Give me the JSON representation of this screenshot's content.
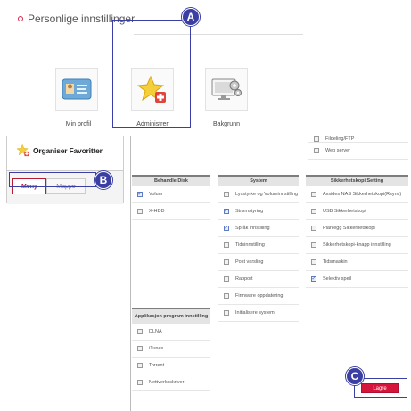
{
  "personal_settings": {
    "title": "Personlige innstillinger",
    "tiles": [
      {
        "label": "Min profil",
        "icon": "id-card-icon"
      },
      {
        "label": "Administrer",
        "icon": "star-plus-icon"
      },
      {
        "label": "Bakgrunn",
        "icon": "monitor-gear-icon"
      }
    ]
  },
  "markers": {
    "a": "A",
    "b": "B",
    "c": "C"
  },
  "organise": {
    "title": "Organiser Favoritter",
    "tabs": [
      {
        "label": "Meny",
        "active": true
      },
      {
        "label": "Mappe",
        "active": false
      }
    ]
  },
  "top_items": [
    {
      "label": "Fildeling/FTP",
      "checked": false
    },
    {
      "label": "Web server",
      "checked": false
    }
  ],
  "columns": {
    "disk": {
      "header": "Behandle Disk",
      "items": [
        {
          "label": "Volum",
          "checked": true
        },
        {
          "label": "X-HDD",
          "checked": false
        }
      ]
    },
    "system": {
      "header": "System",
      "items": [
        {
          "label": "Lysstyrke og Voluminnstilling",
          "checked": false
        },
        {
          "label": "Strømstyring",
          "checked": true
        },
        {
          "label": "Språk innstilling",
          "checked": true
        },
        {
          "label": "Tidsinnstilling",
          "checked": false
        },
        {
          "label": "Post varsling",
          "checked": false
        },
        {
          "label": "Rapport",
          "checked": false
        },
        {
          "label": "Firmware oppdatering",
          "checked": false
        },
        {
          "label": "Initialisere system",
          "checked": false
        }
      ]
    },
    "backup": {
      "header": "Sikkerhetskopi Setting",
      "items": [
        {
          "label": "Avsides NAS Sikkerhetskopi(Rsync)",
          "checked": false
        },
        {
          "label": "USB Sikkerhetskopi",
          "checked": false
        },
        {
          "label": "Planlegg Sikkerhetskopi",
          "checked": false
        },
        {
          "label": "Sikkerhetskopi-knapp innstilling",
          "checked": false
        },
        {
          "label": "Tidsmaskin",
          "checked": false
        },
        {
          "label": "Selektiv speil",
          "checked": true
        }
      ]
    },
    "apps": {
      "header": "Applikasjon program innstilling",
      "items": [
        {
          "label": "DLNA",
          "checked": false
        },
        {
          "label": "iTunes",
          "checked": false
        },
        {
          "label": "Torrent",
          "checked": false
        },
        {
          "label": "Nettverksskriver",
          "checked": false
        }
      ]
    }
  },
  "save_button": "Lagre",
  "colors": {
    "accent": "#d6153c",
    "marker": "#3b3fa3"
  }
}
